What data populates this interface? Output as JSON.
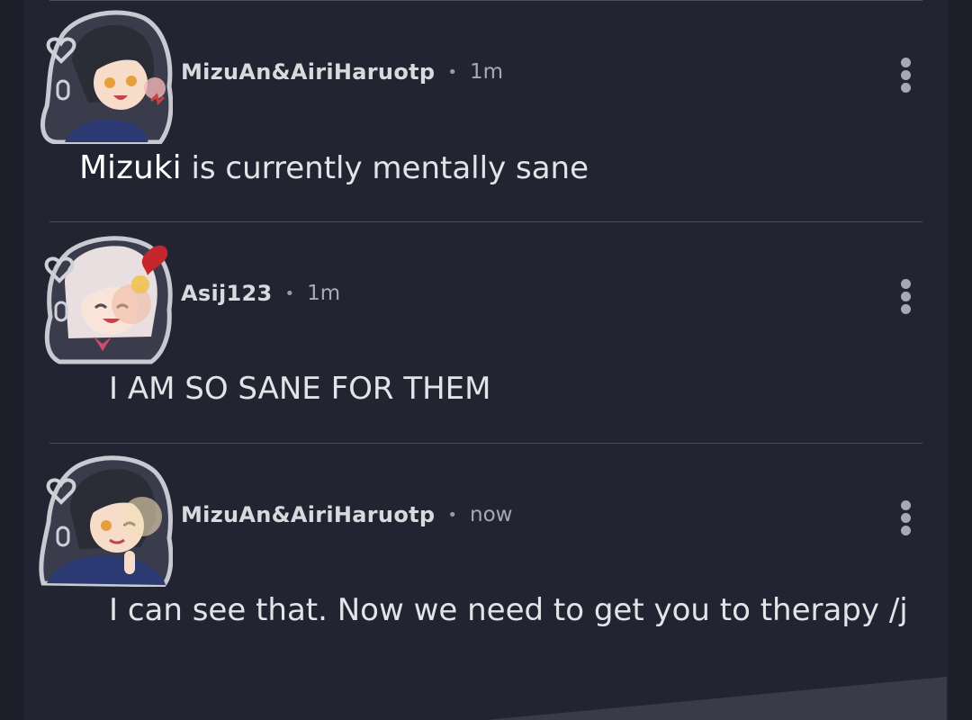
{
  "comments": [
    {
      "username": "MizuAn&AiriHaruotp",
      "separator": "•",
      "time": "1m",
      "mention": "Mizuki",
      "text": "is currently mentally sane",
      "avatar_icon": "anime-avatar-mizuki-icon"
    },
    {
      "username": "Asij123",
      "separator": "•",
      "time": "1m",
      "text": "I AM SO SANE FOR THEM",
      "avatar_icon": "anime-avatar-airi-icon"
    },
    {
      "username": "MizuAn&AiriHaruotp",
      "separator": "•",
      "time": "now",
      "text": "I can see that. Now we need to get you to therapy /j",
      "avatar_icon": "anime-avatar-mizuki-wink-icon"
    }
  ],
  "colors": {
    "background": "#1d1e29",
    "panel": "#232432",
    "divider": "#4a4c5a",
    "username": "#d9d9de"
  }
}
